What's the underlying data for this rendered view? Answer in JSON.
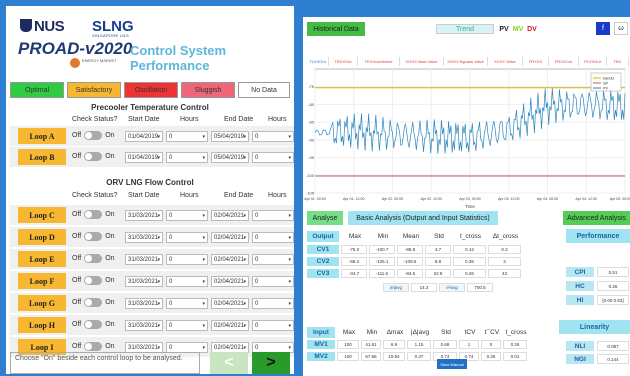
{
  "header": {
    "nus_logo": "NUS",
    "slng_logo": "SLNG",
    "slng_sub": "SINGAPORE LNG",
    "prod_logo": "PROAD-v2020",
    "emblem_text": "ENERGY MARKET",
    "title": "Control System Performance"
  },
  "legend": [
    {
      "label": "Optimal",
      "color": "#2ecc40"
    },
    {
      "label": "Satisfactory",
      "color": "#f7b731"
    },
    {
      "label": "Oscillation",
      "color": "#ee3333"
    },
    {
      "label": "Sluggish",
      "color": "#ee6677"
    },
    {
      "label": "No Data",
      "color": "#ffffff"
    }
  ],
  "precooler": {
    "title": "Precooler Temperature Control",
    "columns": [
      "Check Status?",
      "Start Date",
      "Hours",
      "End Date",
      "Hours"
    ],
    "loops": [
      {
        "name": "Loop A",
        "off": "Off",
        "on": "On",
        "start": "01/04/2019",
        "start_hr": "0",
        "end": "05/04/2019",
        "end_hr": "0"
      },
      {
        "name": "Loop B",
        "off": "Off",
        "on": "On",
        "start": "01/04/2019",
        "start_hr": "0",
        "end": "05/04/2019",
        "end_hr": "0"
      }
    ]
  },
  "orv": {
    "title": "ORV LNG Flow Control",
    "columns": [
      "Check Status?",
      "Start Date",
      "Hours",
      "End Date",
      "Hours"
    ],
    "loops": [
      {
        "name": "Loop C",
        "off": "Off",
        "on": "On",
        "start": "31/03/2021",
        "start_hr": "0",
        "end": "02/04/2021",
        "end_hr": "0"
      },
      {
        "name": "Loop D",
        "off": "Off",
        "on": "On",
        "start": "31/03/2021",
        "start_hr": "0",
        "end": "02/04/2021",
        "end_hr": "0"
      },
      {
        "name": "Loop E",
        "off": "Off",
        "on": "On",
        "start": "31/03/2021",
        "start_hr": "0",
        "end": "02/04/2021",
        "end_hr": "0"
      },
      {
        "name": "Loop F",
        "off": "Off",
        "on": "On",
        "start": "31/03/2021",
        "start_hr": "0",
        "end": "02/04/2021",
        "end_hr": "0"
      },
      {
        "name": "Loop G",
        "off": "Off",
        "on": "On",
        "start": "31/03/2021",
        "start_hr": "0",
        "end": "02/04/2021",
        "end_hr": "0"
      },
      {
        "name": "Loop H",
        "off": "Off",
        "on": "On",
        "start": "31/03/2021",
        "start_hr": "0",
        "end": "02/04/2021",
        "end_hr": "0"
      },
      {
        "name": "Loop I",
        "off": "Off",
        "on": "On",
        "start": "31/03/2021",
        "start_hr": "0",
        "end": "02/04/2021",
        "end_hr": "0"
      }
    ]
  },
  "note": "Choose \"On\" beside each control loop to be analysed.",
  "nav": {
    "prev": "<",
    "next": ">"
  },
  "right": {
    "historical_btn": "Historical Data",
    "trend_label": "Trend",
    "pv": "PV",
    "mv": "MV",
    "dv": "DV",
    "icon_btn1": "f",
    "icon_btn2": "ω",
    "tabs": [
      "TLXXOut",
      "TBXXOut",
      "TEXXcombined",
      "XOOX Main Valve",
      "XOOX Bypass Valve",
      "XXXX Valve",
      "FRXXX",
      "FRXXOut",
      "PLVXOut",
      "TBX"
    ],
    "analyse_btn": "Analyse",
    "basic_title": "Basic Analysis (Output and Input Statistics)",
    "advanced_title": "Advanced Analysis",
    "output_cols": [
      "Output",
      "Max",
      "Min",
      "Mean",
      "Std",
      "t_cross",
      "Δt_cross"
    ],
    "outputs": [
      {
        "name": "CV1",
        "vals": [
          "-75.2",
          "-100.7",
          "-88.8",
          "4.7",
          "0.12",
          "0.3"
        ]
      },
      {
        "name": "CV2",
        "vals": [
          "-68.2",
          "-125.1",
          "-109.6",
          "8.8",
          "0.35",
          "3"
        ]
      },
      {
        "name": "CV3",
        "vals": [
          "-34.7",
          "-111.6",
          "-84.6",
          "22.8",
          "0.26",
          "43"
        ]
      }
    ],
    "bottom_avg_labels": [
      "|e|avg",
      "e²avg"
    ],
    "bottom_avg_vals": [
      "14.3",
      "700.5"
    ],
    "input_cols": [
      "Input",
      "Max",
      "Min",
      "Δmax",
      "|Δ|avg",
      "Std",
      "tCV",
      "t¯CV",
      "t_cross"
    ],
    "inputs": [
      {
        "name": "MV1",
        "vals": [
          "100",
          "41.61",
          "6.9",
          "1.15",
          "0.68",
          "1",
          "0",
          "0.26"
        ]
      },
      {
        "name": "MV2",
        "vals": [
          "100",
          "67.66",
          "19.94",
          "0.37",
          "0.74",
          "0.74",
          "0.26",
          "0.01"
        ]
      }
    ],
    "performance_title": "Performance",
    "perf_rows": [
      {
        "label": "CPI",
        "val": "0.51"
      },
      {
        "label": "HC",
        "val": "0.26"
      },
      {
        "label": "HI",
        "val": "[0.00 0.53]"
      }
    ],
    "linearity_title": "Linearity",
    "lin_rows": [
      {
        "label": "NLI",
        "val": "0.087"
      },
      {
        "label": "NGI",
        "val": "0.144"
      }
    ],
    "save_btn": "Save Manual"
  },
  "chart_data": {
    "type": "line",
    "title": "",
    "xlabel": "Time",
    "ylabel": "",
    "x_ticks": [
      "Apr 01, 00:00",
      "Apr 01, 12:00",
      "Apr 02, 00:00",
      "Apr 02, 12:00",
      "Apr 03, 00:00",
      "Apr 03, 12:00",
      "Apr 04, 00:00",
      "Apr 04, 12:00",
      "Apr 05, 00:00 2019"
    ],
    "y_ticks": [
      "-75",
      "-80",
      "-85",
      "-90",
      "-95",
      "-100",
      "-105"
    ],
    "ylim": [
      -105,
      -70
    ],
    "legend": [
      "bandU",
      "SP",
      "PV"
    ],
    "series": [
      {
        "name": "bandU",
        "color": "#d4b400",
        "values": [
          -75.3,
          -75.3,
          -75.3,
          -75.3,
          -75.3,
          -75.3,
          -75.3,
          -75.3,
          -75.3
        ]
      },
      {
        "name": "SP",
        "color": "#d9534f",
        "values": [
          -100.2,
          -100.2,
          -100.2,
          -100.2,
          -100.2,
          -100.2,
          -100.2,
          -100.2,
          -100.2
        ]
      },
      {
        "name": "PV",
        "color": "#2e86c1",
        "values": [
          -88.0,
          -87.5,
          -88.5,
          -89.0,
          -89.5,
          -87.0,
          -80.5,
          -80.0,
          -80.5
        ]
      }
    ]
  }
}
